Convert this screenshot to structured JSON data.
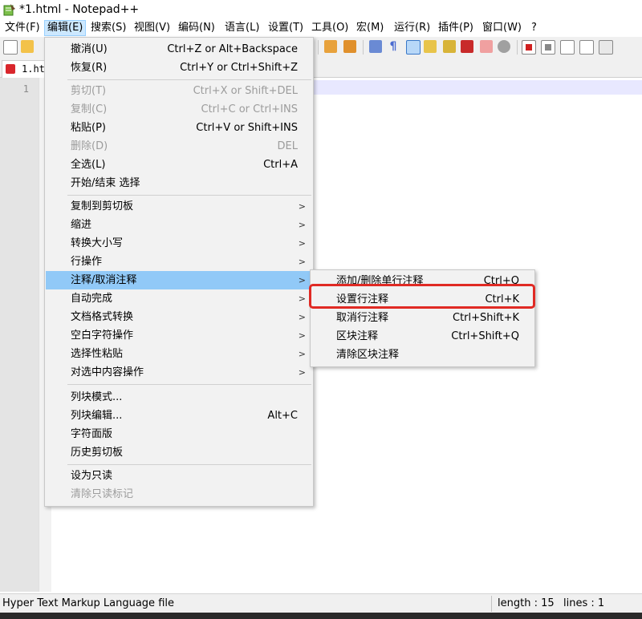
{
  "window": {
    "title": "*1.html - Notepad++"
  },
  "menubar": {
    "items": [
      {
        "label": "文件(F)"
      },
      {
        "label": "编辑(E)"
      },
      {
        "label": "搜索(S)"
      },
      {
        "label": "视图(V)"
      },
      {
        "label": "编码(N)"
      },
      {
        "label": "语言(L)"
      },
      {
        "label": "设置(T)"
      },
      {
        "label": "工具(O)"
      },
      {
        "label": "宏(M)"
      },
      {
        "label": "运行(R)"
      },
      {
        "label": "插件(P)"
      },
      {
        "label": "窗口(W)"
      },
      {
        "label": "?"
      }
    ]
  },
  "tab": {
    "label": "1.html"
  },
  "editor": {
    "line_number": "1"
  },
  "edit_menu": {
    "items": [
      {
        "label": "撤消(U)",
        "shortcut": "Ctrl+Z or Alt+Backspace",
        "disabled": false
      },
      {
        "label": "恢复(R)",
        "shortcut": "Ctrl+Y or Ctrl+Shift+Z",
        "disabled": false
      },
      {
        "label": "剪切(T)",
        "shortcut": "Ctrl+X or Shift+DEL",
        "disabled": true
      },
      {
        "label": "复制(C)",
        "shortcut": "Ctrl+C or Ctrl+INS",
        "disabled": true
      },
      {
        "label": "粘贴(P)",
        "shortcut": "Ctrl+V or Shift+INS",
        "disabled": false
      },
      {
        "label": "删除(D)",
        "shortcut": "DEL",
        "disabled": true
      },
      {
        "label": "全选(L)",
        "shortcut": "Ctrl+A",
        "disabled": false
      },
      {
        "label": "开始/结束 选择",
        "shortcut": "",
        "disabled": false
      },
      {
        "label": "复制到剪切板",
        "submenu": true
      },
      {
        "label": "缩进",
        "submenu": true
      },
      {
        "label": "转换大小写",
        "submenu": true
      },
      {
        "label": "行操作",
        "submenu": true
      },
      {
        "label": "注释/取消注释",
        "submenu": true,
        "highlighted": true
      },
      {
        "label": "自动完成",
        "submenu": true
      },
      {
        "label": "文档格式转换",
        "submenu": true
      },
      {
        "label": "空白字符操作",
        "submenu": true
      },
      {
        "label": "选择性粘贴",
        "submenu": true
      },
      {
        "label": "对选中内容操作",
        "submenu": true
      },
      {
        "label": "列块模式...",
        "shortcut": "",
        "disabled": false
      },
      {
        "label": "列块编辑...",
        "shortcut": "Alt+C",
        "disabled": false
      },
      {
        "label": "字符面版",
        "shortcut": "",
        "disabled": false
      },
      {
        "label": "历史剪切板",
        "shortcut": "",
        "disabled": false
      },
      {
        "label": "设为只读",
        "shortcut": "",
        "disabled": false
      },
      {
        "label": "清除只读标记",
        "shortcut": "",
        "disabled": true
      }
    ]
  },
  "comment_submenu": {
    "items": [
      {
        "label": "添加/删除单行注释",
        "shortcut": "Ctrl+Q"
      },
      {
        "label": "设置行注释",
        "shortcut": "Ctrl+K"
      },
      {
        "label": "取消行注释",
        "shortcut": "Ctrl+Shift+K"
      },
      {
        "label": "区块注释",
        "shortcut": "Ctrl+Shift+Q"
      },
      {
        "label": "清除区块注释",
        "shortcut": ""
      }
    ]
  },
  "statusbar": {
    "filetype": "Hyper Text Markup Language file",
    "length": "length : 15",
    "lines": "lines : 1"
  },
  "colors": {
    "menu_highlight": "#91c9f7",
    "annotation_box": "#e02a24",
    "current_line": "#e8e8ff"
  }
}
